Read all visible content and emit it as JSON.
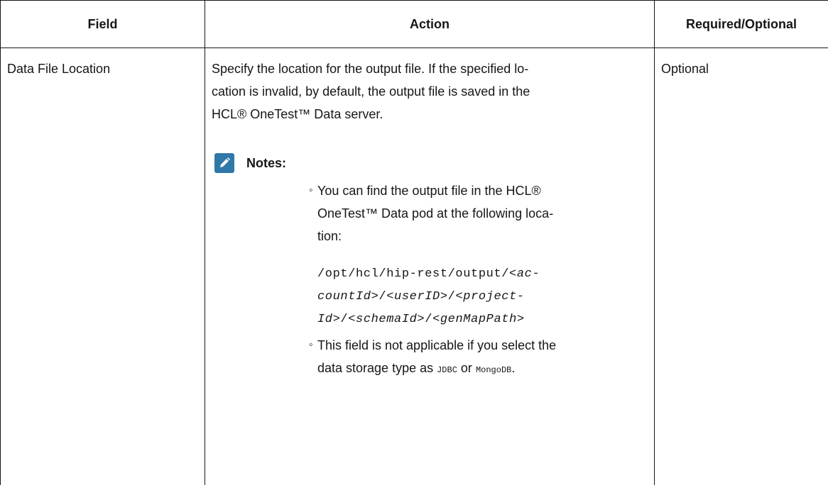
{
  "table": {
    "headers": {
      "field": "Field",
      "action": "Action",
      "required": "Required/Optional"
    },
    "row": {
      "field": "Data File Location",
      "description_line1": "Specify the location for the output file. If the specified lo-",
      "description_line2": "cation is invalid, by default, the output file is saved in the",
      "description_line3": "HCL® OneTest™ Data server.",
      "required": "Optional",
      "notes": {
        "icon": "pencil-note-icon",
        "icon_color": "#2f78a8",
        "label": "Notes:",
        "item1": {
          "line1": "You can find the output file in the HCL®",
          "line2": "OneTest™ Data pod at the following loca-",
          "line3": "tion:",
          "path": {
            "p1": "/opt/hcl/hip-rest/output/",
            "p2": "<ac-",
            "p3": "countId>",
            "p4": "/",
            "p5": "<userID>",
            "p6": "/",
            "p7": "<project-",
            "p8": "Id>",
            "p9": "/",
            "p10": "<schemaId>",
            "p11": "/",
            "p12": "<genMapPath>"
          }
        },
        "item2": {
          "line1": "This field is not applicable if you select the",
          "line2_pre": "data storage type as ",
          "code1": "JDBC",
          "mid": " or ",
          "code2": "MongoDB",
          "end": "."
        }
      }
    }
  }
}
